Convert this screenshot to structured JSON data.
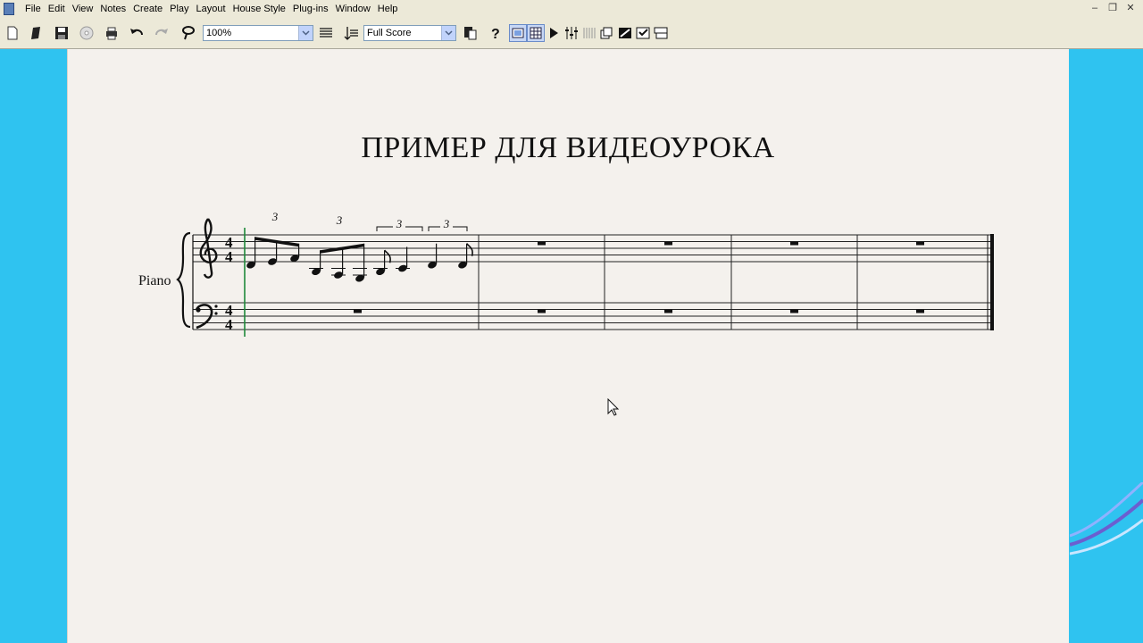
{
  "menu": [
    "File",
    "Edit",
    "View",
    "Notes",
    "Create",
    "Play",
    "Layout",
    "House Style",
    "Plug-ins",
    "Window",
    "Help"
  ],
  "window_controls": [
    "minimize",
    "restore",
    "close"
  ],
  "toolbar": {
    "zoom_value": "100%",
    "view_value": "Full Score",
    "buttons": [
      "new-icon",
      "open-icon",
      "save-icon",
      "cd-icon",
      "print-icon",
      "undo-icon",
      "redo-icon",
      "zoom-lasso-icon",
      "text-lines-icon",
      "transpose-icon",
      "score-icon",
      "help-icon",
      "navigator-icon",
      "keypad-icon",
      "play-icon",
      "mixer-icon",
      "ideas-icon",
      "video-icon",
      "properties-icon",
      "playback-window-icon"
    ]
  },
  "score": {
    "title": "ПРИМЕР ДЛЯ ВИДЕОУРОКА",
    "instrument": "Piano",
    "time_signature": "4/4",
    "tuplet_label": "3",
    "measures": 5
  },
  "colors": {
    "desktop": "#2fc3f0",
    "paper": "#f4f1ed",
    "ink": "#111111",
    "caret": "#1e8a3a"
  }
}
